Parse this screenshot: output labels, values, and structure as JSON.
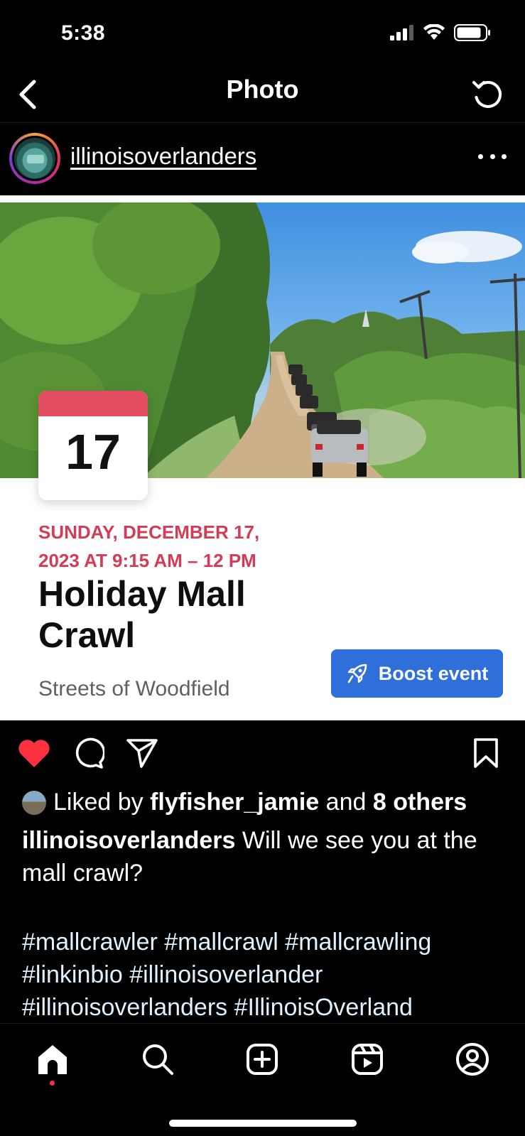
{
  "status_bar": {
    "time": "5:38"
  },
  "nav": {
    "title": "Photo"
  },
  "post": {
    "username": "illinoisoverlanders"
  },
  "event": {
    "day": "17",
    "date_line_1": "SUNDAY, DECEMBER 17,",
    "date_line_2": "2023 AT 9:15 AM – 12 PM",
    "title_line_1": "Holiday Mall",
    "title_line_2": "Crawl",
    "location": "Streets of Woodfield",
    "boost_label": "Boost event",
    "accent_color": "#e24d62",
    "boost_color": "#2f6fd9"
  },
  "likes": {
    "prefix": "Liked by",
    "user": "flyfisher_jamie",
    "middle": "and",
    "others": "8 others"
  },
  "caption": {
    "username": "illinoisoverlanders",
    "text": "Will we see you at the mall crawl?",
    "hashtags_line_1": "#mallcrawler #mallcrawl #mallcrawling",
    "hashtags_line_2": "#linkinbio #illinoisoverlander",
    "hashtags_line_3": "#illinoisoverlanders #IllinoisOverland"
  },
  "icons": {
    "back": "chevron-left-icon",
    "refresh": "refresh-icon",
    "more": "more-horizontal-icon",
    "like": "heart-icon",
    "comment": "comment-icon",
    "share": "send-icon",
    "save": "bookmark-icon",
    "tab_home": "home-icon",
    "tab_search": "search-icon",
    "tab_create": "add-square-icon",
    "tab_reels": "reels-icon",
    "tab_profile": "profile-icon"
  },
  "colors": {
    "like_red": "#ff3040",
    "background": "#000000"
  }
}
